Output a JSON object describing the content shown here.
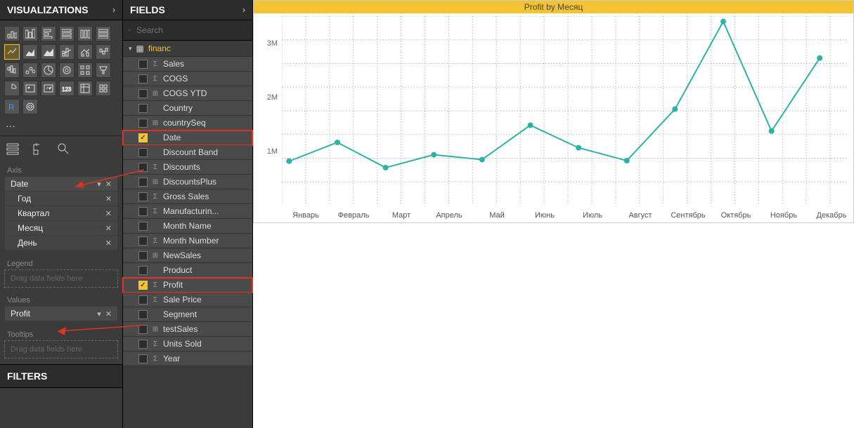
{
  "viz_panel_title": "VISUALIZATIONS",
  "fields_panel_title": "FIELDS",
  "filters_title": "FILTERS",
  "search_placeholder": "Search",
  "table_name": "financ",
  "section_axis": "Axis",
  "section_legend": "Legend",
  "section_values": "Values",
  "section_tooltips": "Tooltips",
  "drag_hint": "Drag data fields here",
  "axis_root": "Date",
  "axis_levels": [
    "Год",
    "Квартал",
    "Месяц",
    "День"
  ],
  "values_item": "Profit",
  "fields": [
    {
      "label": "Sales",
      "sigma": true,
      "checked": false
    },
    {
      "label": "COGS",
      "sigma": true,
      "checked": false
    },
    {
      "label": "COGS YTD",
      "hier": true,
      "checked": false
    },
    {
      "label": "Country",
      "checked": false
    },
    {
      "label": "countrySeq",
      "hier": true,
      "checked": false
    },
    {
      "label": "Date",
      "checked": true,
      "highlight": true
    },
    {
      "label": "Discount Band",
      "checked": false
    },
    {
      "label": "Discounts",
      "sigma": true,
      "checked": false
    },
    {
      "label": "DiscountsPlus",
      "hier": true,
      "checked": false
    },
    {
      "label": "Gross Sales",
      "sigma": true,
      "checked": false
    },
    {
      "label": "Manufacturin...",
      "sigma": true,
      "checked": false
    },
    {
      "label": "Month Name",
      "checked": false
    },
    {
      "label": "Month Number",
      "sigma": true,
      "checked": false
    },
    {
      "label": "NewSales",
      "hier": true,
      "checked": false
    },
    {
      "label": "Product",
      "checked": false
    },
    {
      "label": "Profit",
      "sigma": true,
      "checked": true,
      "highlight": true
    },
    {
      "label": "Sale Price",
      "sigma": true,
      "checked": false
    },
    {
      "label": "Segment",
      "checked": false
    },
    {
      "label": "testSales",
      "hier": true,
      "checked": false
    },
    {
      "label": "Units Sold",
      "sigma": true,
      "checked": false
    },
    {
      "label": "Year",
      "sigma": true,
      "checked": false
    }
  ],
  "chart_title": "Profit by Месяц",
  "y_ticks": [
    "1M",
    "2M",
    "3M"
  ],
  "chart_data": {
    "type": "line",
    "title": "Profit by Месяц",
    "xlabel": "",
    "ylabel": "",
    "ylim": [
      0,
      3500000
    ],
    "categories": [
      "Январь",
      "Февраль",
      "Март",
      "Апрель",
      "Май",
      "Июнь",
      "Июль",
      "Август",
      "Сентябрь",
      "Октябрь",
      "Ноябрь",
      "Декабрь"
    ],
    "values": [
      800000,
      1150000,
      680000,
      920000,
      830000,
      1470000,
      1050000,
      810000,
      1770000,
      3400000,
      1360000,
      2720000
    ]
  }
}
